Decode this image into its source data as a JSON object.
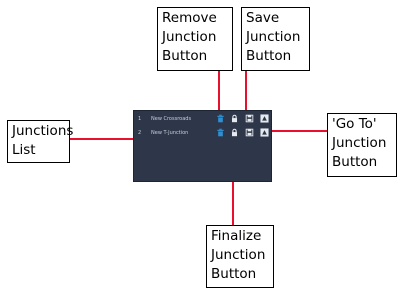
{
  "callouts": {
    "remove": [
      "Remove",
      "Junction",
      "Button"
    ],
    "save": [
      "Save",
      "Junction",
      "Button"
    ],
    "list": [
      "Junctions",
      "List"
    ],
    "goto": [
      "'Go To'",
      "Junction",
      "Button"
    ],
    "finalize": [
      "Finalize",
      "Junction",
      "Button"
    ]
  },
  "junctions": [
    {
      "index": "1",
      "name": "New Crossroads"
    },
    {
      "index": "2",
      "name": "New T-Junction"
    }
  ],
  "colors": {
    "panel": "#2d3749",
    "leader": "#e8112d",
    "remove_icon": "#2f8fd0",
    "icon_light": "#e6e9ee"
  },
  "icons": {
    "remove": "trash-icon",
    "finalize": "lock-icon",
    "save": "floppy-disk-icon",
    "goto": "go-to-triangle-icon"
  }
}
